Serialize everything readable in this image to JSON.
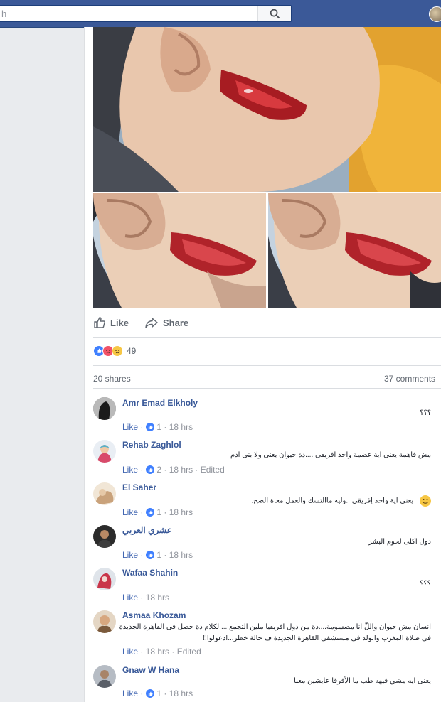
{
  "search": {
    "placeholder": "h",
    "value": ""
  },
  "actions": {
    "like_label": "Like",
    "share_label": "Share"
  },
  "reactions": {
    "count": "49",
    "types": [
      "like",
      "angry",
      "sad"
    ]
  },
  "stats": {
    "shares": "20 shares",
    "comments": "37 comments"
  },
  "colors": {
    "brand": "#3b5998",
    "link": "#385898",
    "meta": "#90949c"
  },
  "comments": [
    {
      "name": "Amr Emad Elkholy",
      "text": "؟؟؟",
      "like": "Like",
      "reactions": "1",
      "time": "18 hrs",
      "edited": ""
    },
    {
      "name": "Rehab Zaghlol",
      "text": "مش فاهمة يعنى اية عضمة واحد افريقى ....دة حيوان يعنى ولا بنى ادم",
      "like": "Like",
      "reactions": "2",
      "time": "18 hrs",
      "edited": "Edited"
    },
    {
      "name": "El Saher",
      "text": "يعنى اية واحد إفريقي ..وليه ماالتسك والعمل معاة الصح.",
      "like": "Like",
      "reactions": "1",
      "time": "18 hrs",
      "edited": ""
    },
    {
      "name": "عشري العربي",
      "text": "دول اكلى لحوم البشر",
      "like": "Like",
      "reactions": "1",
      "time": "18 hrs",
      "edited": ""
    },
    {
      "name": "Wafaa Shahin",
      "text": "؟؟؟",
      "like": "Like",
      "reactions": "",
      "time": "18 hrs",
      "edited": ""
    },
    {
      "name": "Asmaa Khozam",
      "text": "انسان مش حيوان واللّٰ انا مصسومة....دة من دول افريقيا ملين التجمع ...الكلام دة حصل فى القاهرة الجديدة",
      "text2": "فى صلاة المغرب والولد فى مستشفى القاهرة الجديدة ف حالة خطر...ادعولوا!!",
      "like": "Like",
      "reactions": "",
      "time": "18 hrs",
      "edited": "Edited"
    },
    {
      "name": "Gnaw W Hana",
      "text": "يعنى ايه مشي فيهه طب ما الأفرقا عايشين معنا",
      "like": "Like",
      "reactions": "1",
      "time": "18 hrs",
      "edited": ""
    }
  ]
}
